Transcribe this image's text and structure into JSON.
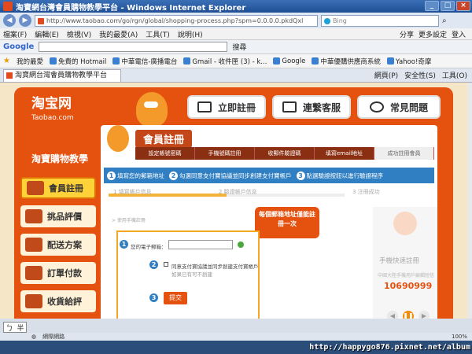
{
  "window": {
    "title": "淘寶網台灣會員購物教學平台 - Windows Internet Explorer",
    "minimize": "_",
    "maximize": "□",
    "close": "×"
  },
  "address": {
    "url": "http://www.taobao.com/go/rgn/global/shopping-process.php?spm=0.0.0.0.pkdQxl",
    "search_placeholder": "Bing"
  },
  "menu": [
    "檔案(F)",
    "編輯(E)",
    "檢視(V)",
    "我的最愛(A)",
    "工具(T)",
    "說明(H)"
  ],
  "menu_right": [
    "分享",
    "更多設定",
    "登入"
  ],
  "google_toolbar": {
    "label": "Google",
    "search": "搜尋"
  },
  "favorites": {
    "label": "我的最愛",
    "items": [
      "免費的 Hotmail",
      "中華電信-廣播電台",
      "Gmail - 收件匣 (3) - k...",
      "Google",
      "中華優購供應商系統",
      "Yahoo!奇摩"
    ]
  },
  "tab": {
    "title": "淘寶網台灣會員購物教學平台",
    "commands": [
      "網頁(P)",
      "安全性(S)",
      "工具(O)"
    ]
  },
  "site": {
    "logo_cn": "淘宝网",
    "logo_en": "Taobao.com",
    "top_buttons": [
      "立即註冊",
      "連繫客服",
      "常見問題"
    ],
    "sidebar_title": "淘寶購物教學",
    "sidebar_items": [
      "會員註冊",
      "挑品評價",
      "配送方案",
      "訂單付款",
      "收貨給評"
    ]
  },
  "panel": {
    "title": "會員註冊",
    "steps": [
      "設定帳號密碼",
      "手機號碼註冊",
      "收郵件驗證碼",
      "填寫email地址",
      "成功註冊會員"
    ],
    "blue_steps": [
      "填寫您的郵箱地址",
      "勾選同意支付寶協議並同步創建支付寶帳戶",
      "點選驗證按鈕以進行驗證程序"
    ],
    "progress_labels": [
      "1 填寫帳戶信息",
      "2 驗證帳戶信息",
      "3 注冊成功"
    ],
    "progress_level": 0.5,
    "tiny_note": "> 使用手機註冊",
    "callout": "每個郵箱地址僅能註冊一次",
    "email_label": "您的電子郵箱：",
    "agree_text": "同意支付寶協議並同步創建支付寶帳戶",
    "agree_sub": "如果已有可不創建",
    "submit": "提交",
    "mobile_label": "手機快速註冊",
    "mobile_sub": "中國大陸手機用戶編輯短信",
    "mobile_number": "10690999"
  },
  "status": {
    "left": "網際網路",
    "zoom": "100%"
  },
  "ime": [
    "ㄅ",
    "半"
  ],
  "watermark": "http://happygo876.pixnet.net/album"
}
